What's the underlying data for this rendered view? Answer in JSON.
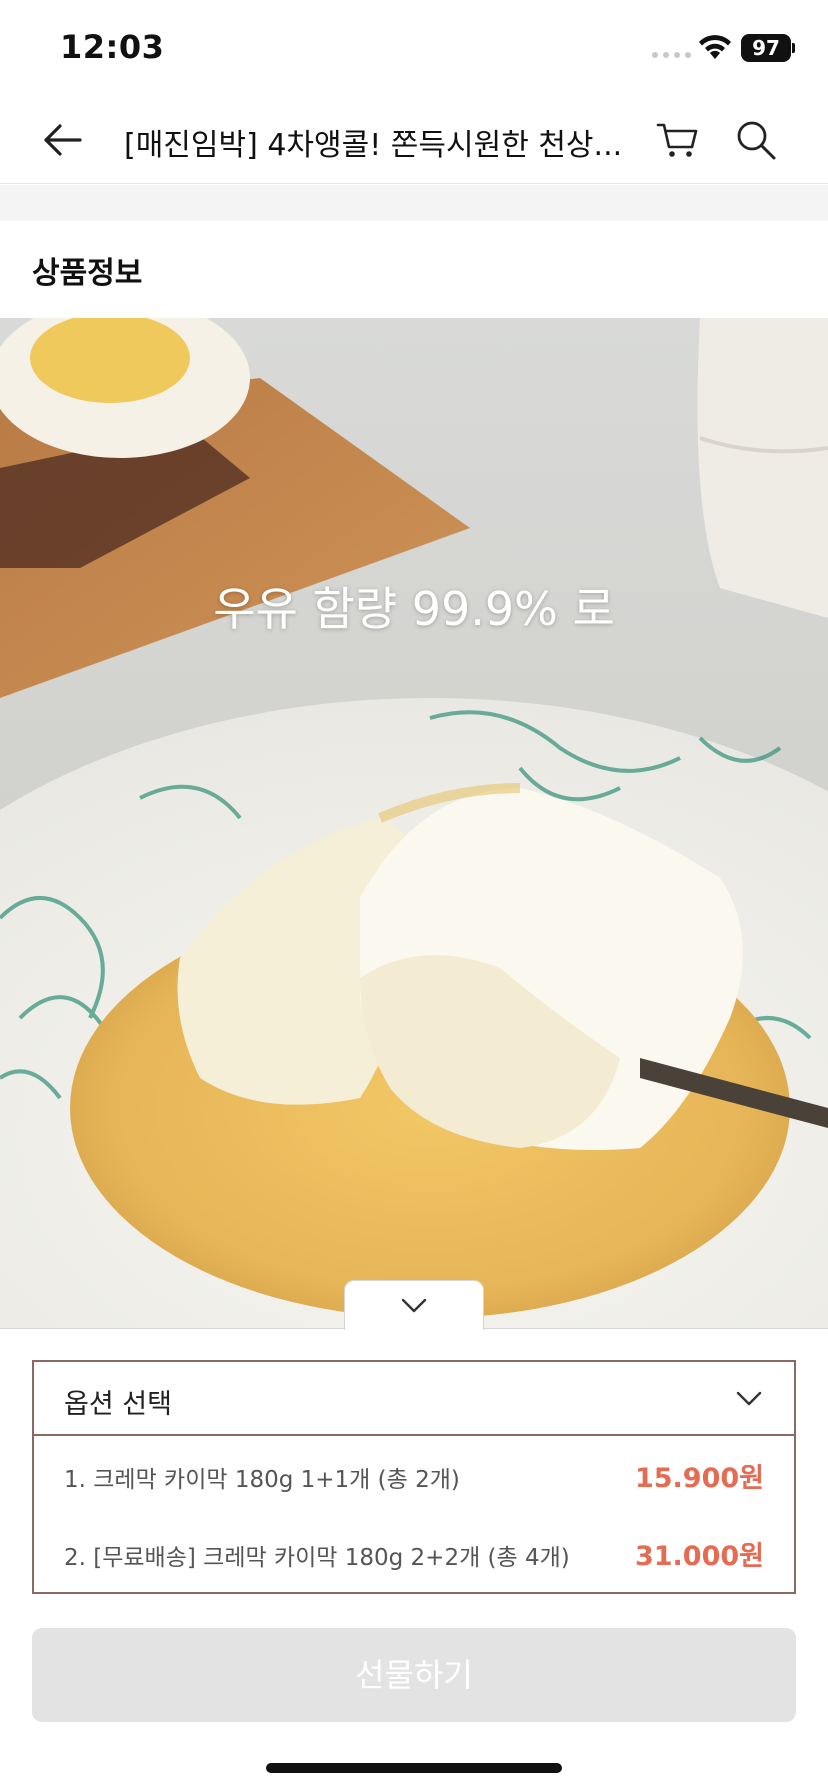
{
  "status_bar": {
    "time": "12:03",
    "battery": "97"
  },
  "header": {
    "title": "[매진임박] 4차앵콜! 쫀득시원한 천상..."
  },
  "section": {
    "title": "상품정보"
  },
  "product_image": {
    "overlay_text": "우유 함량 99.9% 로"
  },
  "options": {
    "header_label": "옵션 선택",
    "items": [
      {
        "name": "1. 크레막 카이막 180g 1+1개 (총 2개)",
        "price": "15.900원"
      },
      {
        "name": "2. [무료배송] 크레막 카이막 180g 2+2개 (총 4개)",
        "price": "31.000원"
      }
    ]
  },
  "gift_button": {
    "label": "선물하기"
  },
  "colors": {
    "price": "#e56b52",
    "option_border": "#8a6a62",
    "disabled_button": "#e3e3e3"
  }
}
